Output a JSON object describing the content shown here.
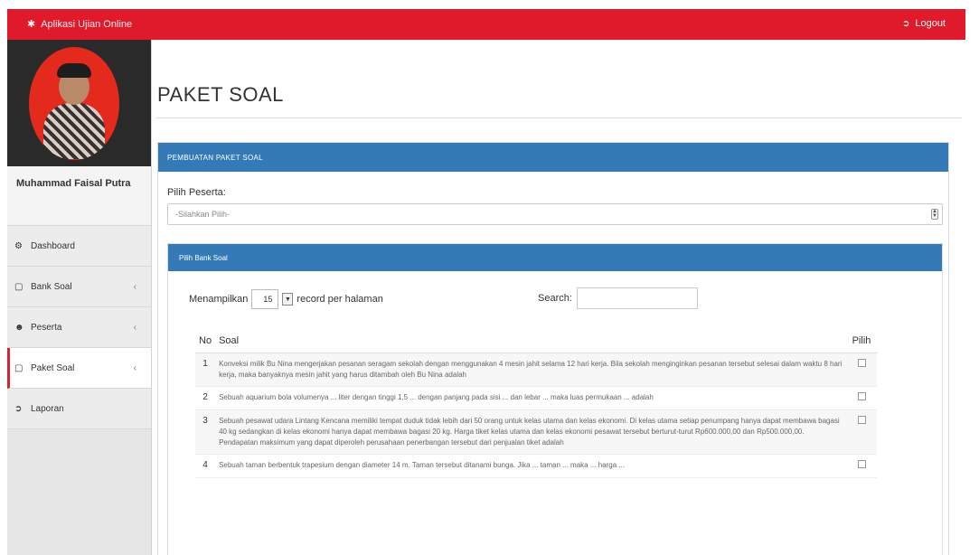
{
  "app": {
    "title": "Aplikasi Ujian Online",
    "logout_label": "Logout"
  },
  "sidebar": {
    "user_name": "Muhammad Faisal Putra",
    "items": [
      {
        "label": "Dashboard",
        "icon": "dashboard-icon",
        "has_children": false,
        "active": false
      },
      {
        "label": "Bank Soal",
        "icon": "square-icon",
        "has_children": true,
        "active": false
      },
      {
        "label": "Peserta",
        "icon": "user-icon",
        "has_children": true,
        "active": false
      },
      {
        "label": "Paket Soal",
        "icon": "square-icon",
        "has_children": true,
        "active": true
      },
      {
        "label": "Laporan",
        "icon": "signout-icon",
        "has_children": false,
        "active": false
      }
    ]
  },
  "page": {
    "title": "PAKET SOAL",
    "panel_title": "PEMBUATAN PAKET SOAL",
    "peserta_label": "Pilih Peserta:",
    "peserta_selected": "-Silahkan Pilih-",
    "bank_panel_title": "Pilih Bank Soal",
    "length_prefix": "Menampilkan",
    "length_value": "15",
    "length_suffix": "record per halaman",
    "search_label": "Search:"
  },
  "table": {
    "headers": [
      "No",
      "Soal",
      "Pilih"
    ],
    "rows": [
      {
        "no": "1",
        "soal": "Konveksi milik Bu Nina mengerjakan pesanan seragam sekolah dengan menggunakan 4 mesin jahit selama 12 hari kerja. Bila sekolah menginginkan pesanan tersebut selesai dalam waktu 8 hari kerja, maka banyaknya mesin jahit yang harus ditambah oleh Bu Nina adalah",
        "checked": false
      },
      {
        "no": "2",
        "soal": "Sebuah aquarium bola volumenya ... liter dengan tinggi 1,5 ... dengan panjang pada sisi ... dan lebar ... maka luas permukaan ... adalah",
        "checked": false
      },
      {
        "no": "3",
        "soal": "Sebuah pesawat udara Lintang Kencana memiliki tempat duduk tidak lebih dari 50 orang untuk kelas utama dan kelas ekonomi. Di kelas utama setiap penumpang hanya dapat membawa bagasi 40 kg sedangkan di kelas ekonomi hanya dapat membawa bagasi 20 kg. Harga tiket kelas utama dan kelas ekonomi pesawat tersebut berturut-turut Rp600.000,00 dan Rp500.000,00. Pendapatan maksimum yang dapat diperoleh perusahaan penerbangan tersebut dari penjualan tiket adalah",
        "checked": false
      },
      {
        "no": "4",
        "soal": "Sebuah taman berbentuk trapesium dengan diameter 14 m. Taman tersebut ditanami bunga. Jika ... taman ... maka ... harga ...",
        "checked": false
      }
    ]
  },
  "colors": {
    "accent": "#e01a2b",
    "panel": "#337ab7"
  }
}
